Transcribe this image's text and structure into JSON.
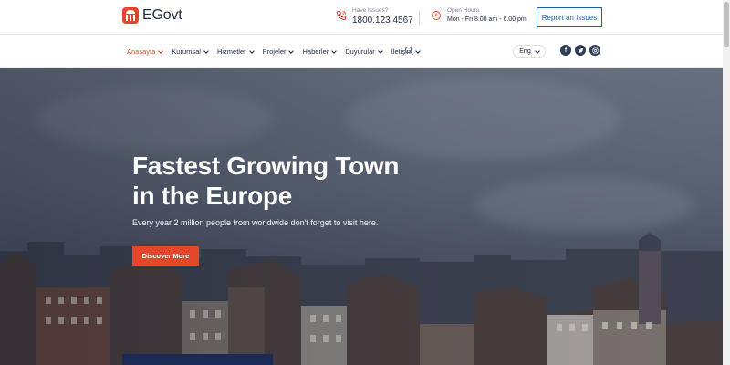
{
  "brand": {
    "name": "EGovt",
    "logo_icon": "government-building-icon"
  },
  "contact": {
    "phone": {
      "label": "Have Issues?",
      "value": "1800.123 4567",
      "icon": "phone-icon"
    },
    "hours": {
      "label": "Open Hours",
      "value": "Mon - Fri 8.00 am - 6.00 pm",
      "icon": "clock-icon"
    }
  },
  "report_button": "Report an Issues",
  "nav": {
    "items": [
      {
        "label": "Anasayfa",
        "active": true
      },
      {
        "label": "Kurumsal"
      },
      {
        "label": "Hizmetler"
      },
      {
        "label": "Projeler"
      },
      {
        "label": "Haberler"
      },
      {
        "label": "Duyurular"
      },
      {
        "label": "İletişim"
      }
    ],
    "language": "Eng"
  },
  "socials": [
    "facebook-icon",
    "twitter-icon",
    "instagram-icon"
  ],
  "hero": {
    "title_line1": "Fastest Growing Town",
    "title_line2": "in the Europe",
    "subtitle": "Every year 2 million people from worldwide don't forget to visit here.",
    "cta": "Discover More"
  },
  "colors": {
    "accent": "#e5452a",
    "primary": "#1e5bb8",
    "dark": "#1e2a44"
  }
}
